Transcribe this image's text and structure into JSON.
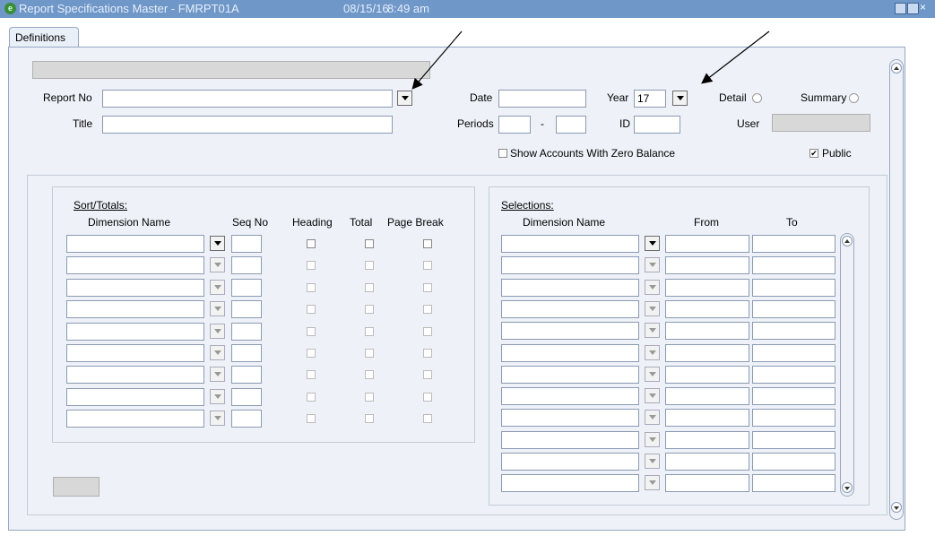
{
  "window": {
    "title": "Report Specifications Master - FMRPT01A",
    "date": "08/15/16",
    "time": "8:49 am"
  },
  "tab": {
    "label": "Definitions"
  },
  "form": {
    "report_no_label": "Report No",
    "title_label": "Title",
    "date_label": "Date",
    "year_label": "Year",
    "year_value": "17",
    "periods_label": "Periods",
    "period_sep": "-",
    "id_label": "ID",
    "detail_label": "Detail",
    "summary_label": "Summary",
    "user_label": "User",
    "zero_balance_label": "Show Accounts With Zero Balance",
    "public_label": "Public",
    "public_checked": "✔"
  },
  "sort_totals": {
    "title": "Sort/Totals:",
    "columns": [
      "Dimension Name",
      "Seq No",
      "Heading",
      "Total",
      "Page Break"
    ]
  },
  "selections": {
    "title": "Selections:",
    "columns": [
      "Dimension Name",
      "From",
      "To"
    ]
  },
  "window_controls": {
    "close": "×"
  }
}
